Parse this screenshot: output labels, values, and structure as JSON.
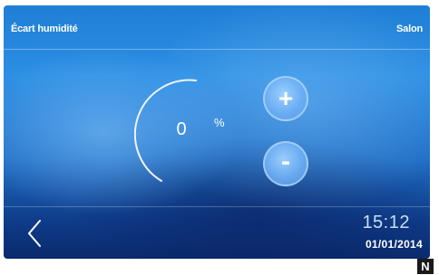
{
  "header": {
    "title": "Écart humidité",
    "room": "Salon"
  },
  "gauge": {
    "value": "0",
    "unit": "%"
  },
  "controls": {
    "plus_label": "+",
    "minus_label": "-"
  },
  "footer": {
    "time": "15:12",
    "date": "01/01/2014"
  },
  "badge": {
    "letter": "N"
  },
  "icons": {
    "back": "chevron-left-icon"
  }
}
